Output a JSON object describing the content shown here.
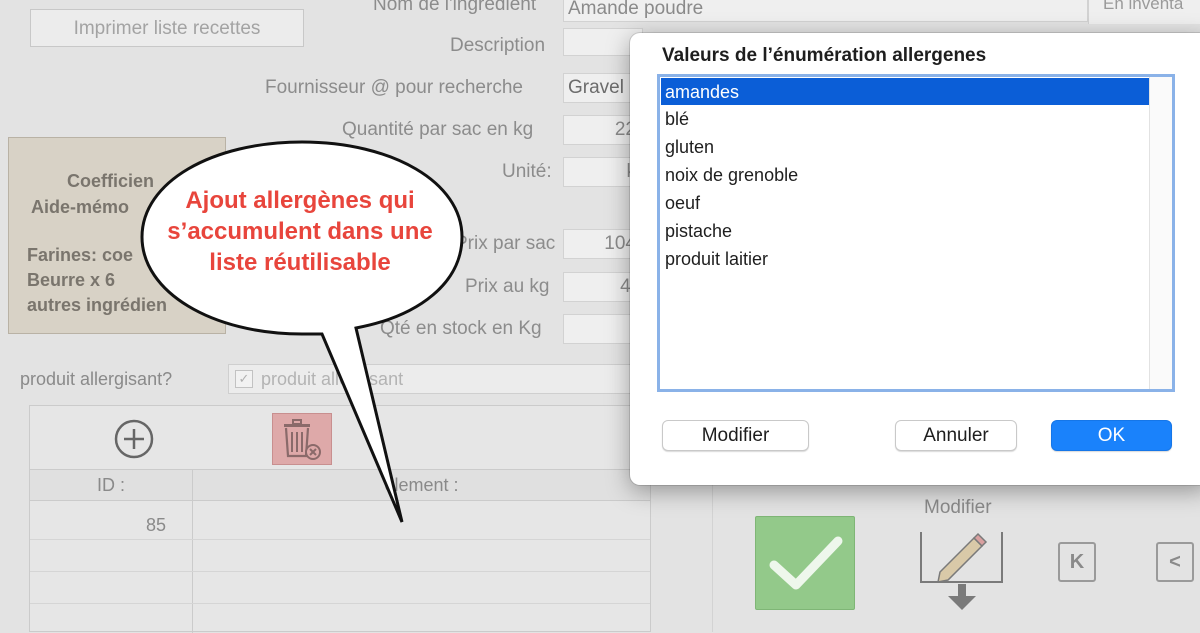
{
  "form": {
    "print_button": "Imprimer liste recettes",
    "labels": {
      "ingredient_name": "Nom de l'ingrédient",
      "description": "Description",
      "supplier": "Fournisseur @ pour recherche",
      "qty_per_bag": "Quantité par sac en kg",
      "unit": "Unité:",
      "price_per_bag": "Prix par sac",
      "price_per_kg": "Prix au kg",
      "stock_qty": "Qté en stock en Kg"
    },
    "values": {
      "ingredient_name": "Amande poudre",
      "supplier": "Gravel",
      "qty_per_bag": "22",
      "unit": "k",
      "price_per_bag": "104",
      "price_per_kg": "4,"
    },
    "inventory_label": "En inventa"
  },
  "coef_box": {
    "line1": "Coefficien",
    "line2": "Aide-mémo",
    "line3": "Farines: coe",
    "line4": "Beurre x 6",
    "line5": "autres ingrédien"
  },
  "allergen": {
    "label": "produit allergisant?",
    "checkbox_text": "produit allergisant"
  },
  "list_panel": {
    "col_id": "ID :",
    "col_element": "element :",
    "rows": [
      {
        "id": "85",
        "element": ""
      }
    ]
  },
  "bottom": {
    "modifier_label": "Modifier",
    "nav_first": "K",
    "nav_prev": "<"
  },
  "callout": {
    "text": "Ajout allergènes qui s’accumulent dans une liste réutilisable"
  },
  "dialog": {
    "title": "Valeurs de l’énumération allergenes",
    "items": [
      "amandes",
      "blé",
      "gluten",
      "noix de grenoble",
      "oeuf",
      "pistache",
      "produit laitier"
    ],
    "selected_index": 0,
    "buttons": {
      "modify": "Modifier",
      "cancel": "Annuler",
      "ok": "OK"
    }
  },
  "colors": {
    "selection": "#0b5ed7",
    "primary_button": "#1a82fb",
    "callout_text": "#e8453c",
    "check_green": "#93c98a",
    "delete_red": "#dea9a9"
  }
}
